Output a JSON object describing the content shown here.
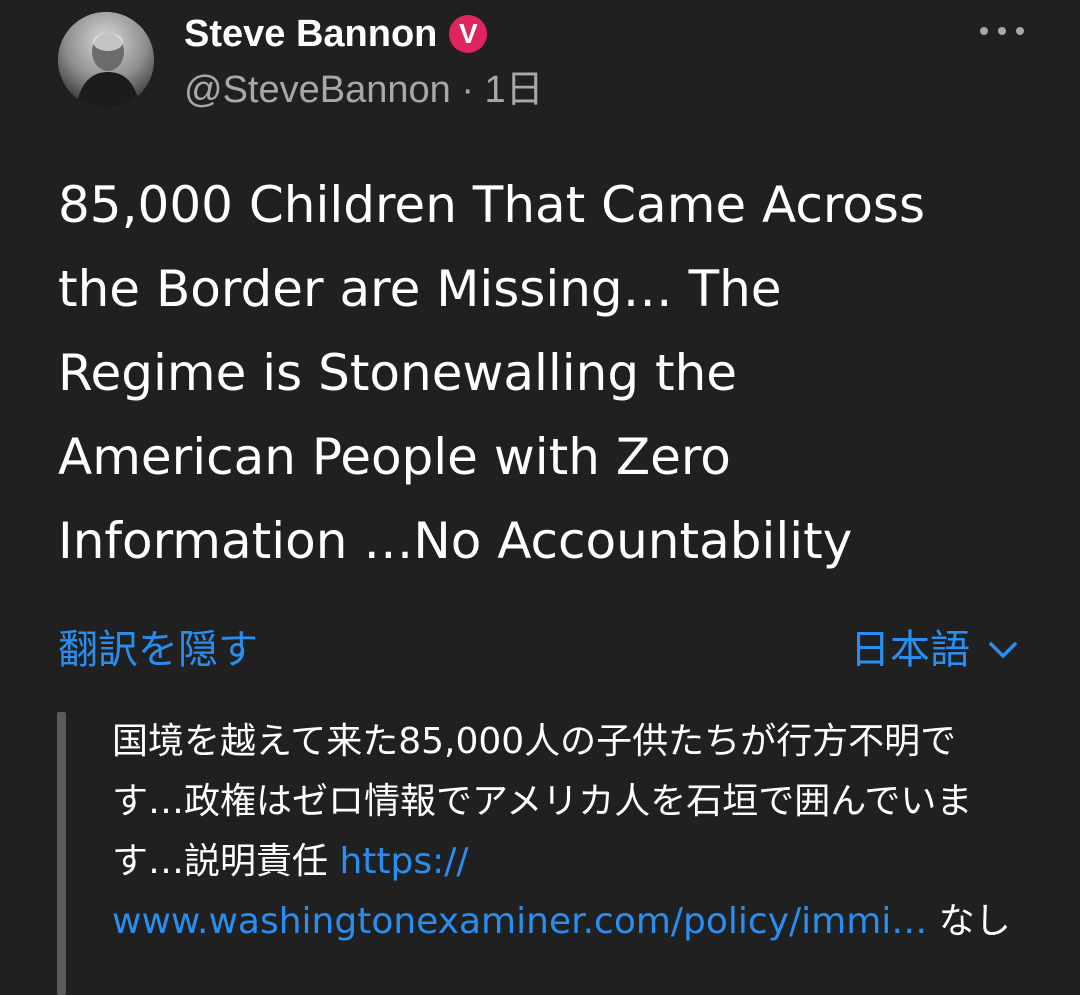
{
  "author": {
    "name": "Steve Bannon",
    "verified_badge": "V",
    "handle": "@SteveBannon",
    "separator": "·",
    "time": "1日"
  },
  "tweet": {
    "text": "85,000 Children That Came Across\nthe Border are Missing… The\nRegime is Stonewalling the\nAmerican People with Zero\nInformation …No Accountability"
  },
  "translation": {
    "hide_label": "翻訳を隠す",
    "language": "日本語",
    "text_before": "国境を越えて来た85,000人の子供たちが行方不明です…政権はゼロ情報でアメリカ人を石垣で囲んでいます…説明責任 ",
    "link_prefix": "https://",
    "link_body": "www.washingtonexaminer.com/policy/immi…",
    "text_after": " なし"
  },
  "icons": {
    "more": "more-horizontal-icon",
    "chevron": "chevron-down-icon",
    "verified": "verified-badge-icon"
  },
  "colors": {
    "background": "#202020",
    "link": "#2a8ef0",
    "secondary_text": "#a8a8a8",
    "verified": "#e0245e"
  }
}
